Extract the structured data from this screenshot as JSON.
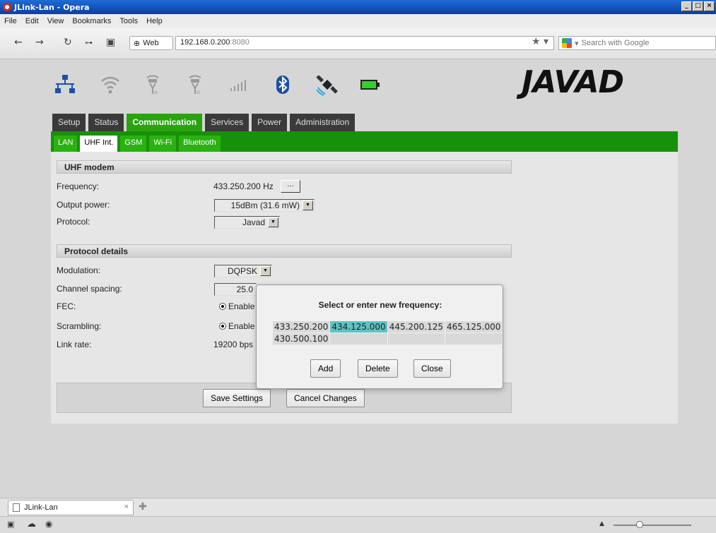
{
  "window": {
    "title": "JLink-Lan - Opera"
  },
  "menu": [
    "File",
    "Edit",
    "View",
    "Bookmarks",
    "Tools",
    "Help"
  ],
  "address": {
    "badge": "Web",
    "host": "192.168.0.200",
    "port": ":8080",
    "search_placeholder": "Search with Google"
  },
  "header": {
    "logo": "JAVAD",
    "icons": [
      "network-icon",
      "wifi-icon",
      "modem-icon",
      "modem-icon",
      "signal-icon",
      "bluetooth-icon",
      "satellite-icon",
      "battery-icon"
    ]
  },
  "main_tabs": [
    "Setup",
    "Status",
    "Communication",
    "Services",
    "Power",
    "Administration"
  ],
  "active_main_tab": "Communication",
  "sub_tabs": [
    "LAN",
    "UHF Int.",
    "GSM",
    "Wi-Fi",
    "Bluetooth"
  ],
  "active_sub_tab": "UHF Int.",
  "uhf": {
    "section": "UHF modem",
    "frequency_label": "Frequency:",
    "frequency_value": "433.250.200 Hz",
    "frequency_button": "...",
    "output_power_label": "Output power:",
    "output_power_value": "15dBm (31.6 mW)",
    "protocol_label": "Protocol:",
    "protocol_value": "Javad"
  },
  "details": {
    "section": "Protocol details",
    "modulation_label": "Modulation:",
    "modulation_value": "DQPSK",
    "channel_spacing_label": "Channel spacing:",
    "channel_spacing_value": "25.0",
    "fec_label": "FEC:",
    "fec_value": "Enable",
    "scrambling_label": "Scrambling:",
    "scrambling_value": "Enable",
    "link_rate_label": "Link rate:",
    "link_rate_value": "19200 bps"
  },
  "actions": {
    "save": "Save Settings",
    "cancel": "Cancel Changes"
  },
  "dialog": {
    "title": "Select or enter new frequency:",
    "frequencies": [
      [
        "433.250.200",
        "434.125.000",
        "445.200.125",
        "465.125.000"
      ],
      [
        "430.500.100",
        "",
        "",
        ""
      ]
    ],
    "selected": "434.125.000",
    "buttons": {
      "add": "Add",
      "delete": "Delete",
      "close": "Close"
    }
  },
  "browser_tab": {
    "label": "JLink-Lan"
  },
  "colors": {
    "accent_green": "#2aa30f",
    "dark_tab": "#3a3a3a",
    "selected_cell": "#5ec3c3"
  }
}
